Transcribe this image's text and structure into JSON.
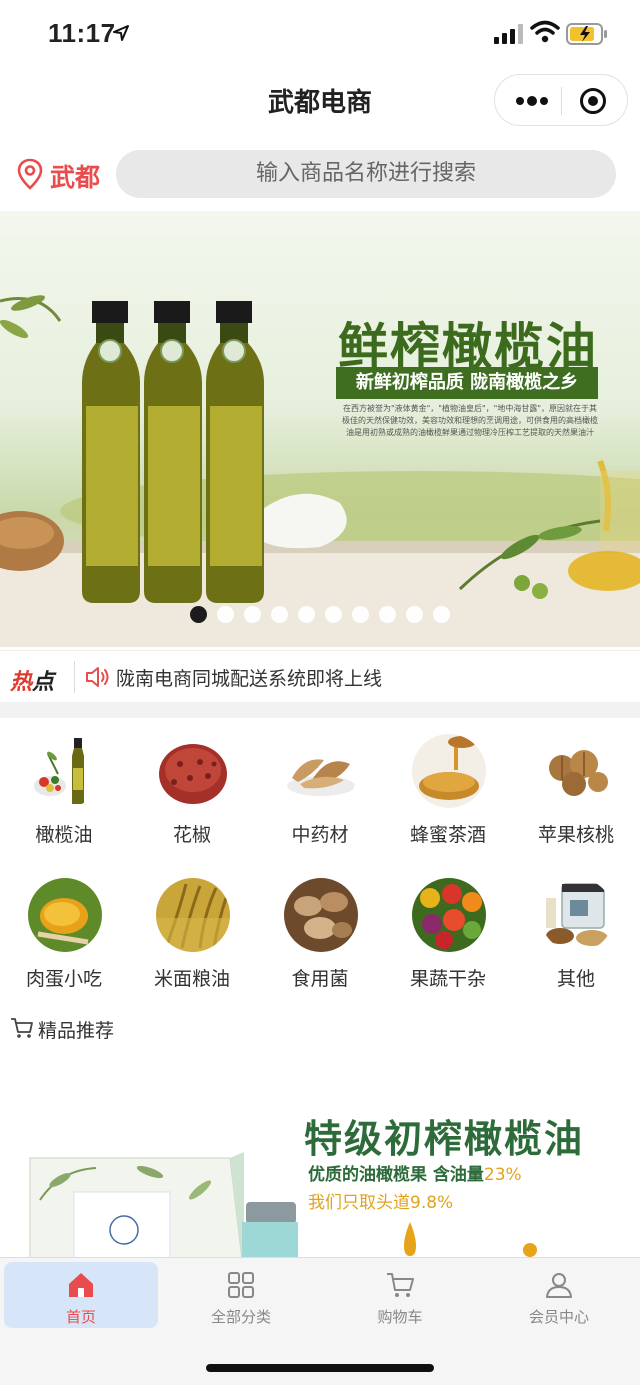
{
  "status_bar": {
    "time": "11:17"
  },
  "header": {
    "title": "武都电商"
  },
  "search": {
    "location": "武都",
    "placeholder": "输入商品名称进行搜索"
  },
  "banner": {
    "headline": "鲜榨橄榄油",
    "subline": "新鲜初榨品质  陇南橄榄之乡",
    "body": "在西方被誉为\"液体黄金\"，\"植物油皇后\"，\"地中海甘露\"，原因就在于其极佳的天然保健功效，美容功效和理想的烹调用途，可供食用的高档橄榄油是用初熟或成熟的油橄榄鲜果通过物理冷压榨工艺提取的天然果油汁",
    "page_count": 10,
    "active_page": 1
  },
  "news": {
    "hot_label_1": "热",
    "hot_label_2": "点",
    "text": "陇南电商同城配送系统即将上线"
  },
  "categories": [
    {
      "label": "橄榄油",
      "icon": "olive-oil-icon"
    },
    {
      "label": "花椒",
      "icon": "sichuan-pepper-icon"
    },
    {
      "label": "中药材",
      "icon": "herbal-medicine-icon"
    },
    {
      "label": "蜂蜜茶酒",
      "icon": "honey-icon"
    },
    {
      "label": "苹果核桃",
      "icon": "walnut-icon"
    },
    {
      "label": "肉蛋小吃",
      "icon": "egg-snack-icon"
    },
    {
      "label": "米面粮油",
      "icon": "grain-icon"
    },
    {
      "label": "食用菌",
      "icon": "mushroom-icon"
    },
    {
      "label": "果蔬干杂",
      "icon": "fruit-veg-icon"
    },
    {
      "label": "其他",
      "icon": "other-icon"
    }
  ],
  "recommend": {
    "title": "精品推荐"
  },
  "promo": {
    "headline": "特级初榨橄榄油",
    "line1_prefix": "优质的油橄榄果 含油量",
    "line1_value": "23%",
    "line2": "我们只取头道9.8%"
  },
  "tabbar": [
    {
      "label": "首页",
      "icon": "home-icon",
      "active": true
    },
    {
      "label": "全部分类",
      "icon": "grid-icon",
      "active": false
    },
    {
      "label": "购物车",
      "icon": "cart-icon",
      "active": false
    },
    {
      "label": "会员中心",
      "icon": "user-icon",
      "active": false
    }
  ],
  "colors": {
    "accent": "#e84c4c",
    "tab_active_bg": "#d6e6f8",
    "promo_green": "#2e6b3a",
    "promo_gold": "#e0a31f"
  }
}
